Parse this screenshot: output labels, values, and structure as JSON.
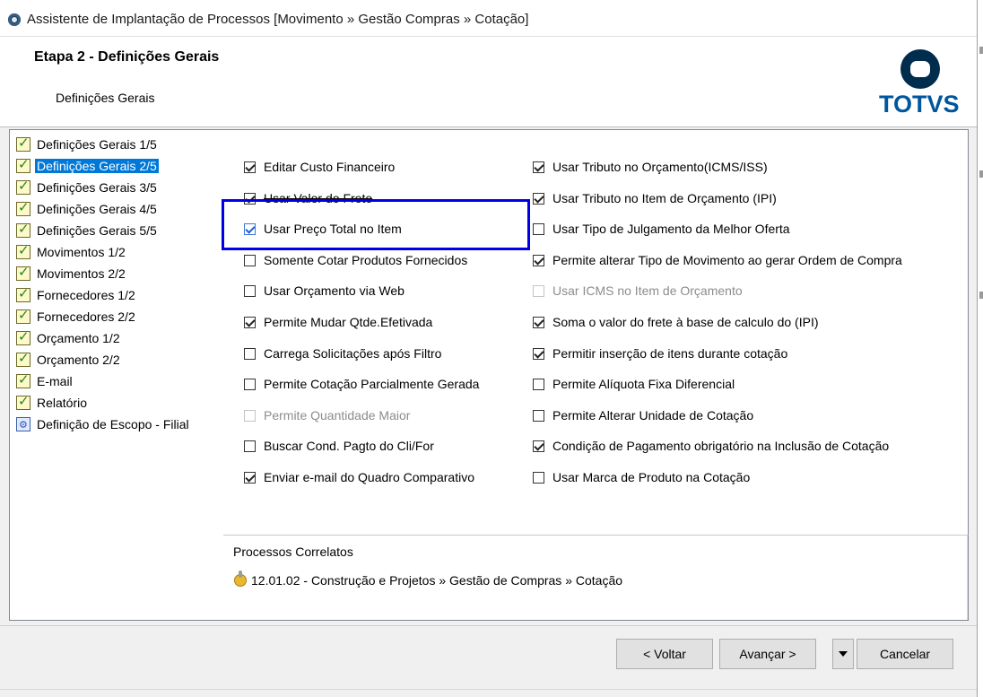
{
  "window": {
    "title": "Assistente de Implantação de Processos [Movimento » Gestão Compras » Cotação]"
  },
  "header": {
    "step_title": "Etapa 2 - Definições Gerais",
    "subtitle": "Definições Gerais",
    "logo_text": "TOTVS"
  },
  "steps": [
    {
      "label": "Definições Gerais 1/5",
      "icon": "checklist-icon"
    },
    {
      "label": "Definições Gerais 2/5",
      "icon": "checklist-icon",
      "selected": true
    },
    {
      "label": "Definições Gerais 3/5",
      "icon": "checklist-icon"
    },
    {
      "label": "Definições Gerais 4/5",
      "icon": "checklist-icon"
    },
    {
      "label": "Definições Gerais 5/5",
      "icon": "checklist-icon"
    },
    {
      "label": "Movimentos 1/2",
      "icon": "checklist-icon"
    },
    {
      "label": "Movimentos 2/2",
      "icon": "checklist-icon"
    },
    {
      "label": "Fornecedores 1/2",
      "icon": "checklist-icon"
    },
    {
      "label": "Fornecedores 2/2",
      "icon": "checklist-icon"
    },
    {
      "label": "Orçamento 1/2",
      "icon": "checklist-icon"
    },
    {
      "label": "Orçamento 2/2",
      "icon": "checklist-icon"
    },
    {
      "label": "E-mail",
      "icon": "checklist-icon"
    },
    {
      "label": "Relatório",
      "icon": "checklist-icon"
    },
    {
      "label": "Definição de Escopo - Filial",
      "icon": "scope-icon"
    }
  ],
  "options_left": [
    {
      "label": "Editar Custo Financeiro",
      "checked": true
    },
    {
      "label": "Usar Valor do Frete",
      "checked": true,
      "struck": true
    },
    {
      "label": "Usar  Preço Total no Item",
      "checked": true,
      "highlighted": true
    },
    {
      "label": "Somente Cotar Produtos Fornecidos",
      "checked": false
    },
    {
      "label": "Usar Orçamento via Web",
      "checked": false
    },
    {
      "label": "Permite Mudar Qtde.Efetivada",
      "checked": true
    },
    {
      "label": "Carrega Solicitações após Filtro",
      "checked": false
    },
    {
      "label": "Permite Cotação Parcialmente Gerada",
      "checked": false
    },
    {
      "label": "Permite Quantidade Maior",
      "checked": false,
      "disabled": true
    },
    {
      "label": "Buscar Cond. Pagto do Cli/For",
      "checked": false
    },
    {
      "label": "Enviar e-mail do Quadro Comparativo",
      "checked": true
    }
  ],
  "options_right": [
    {
      "label": "Usar Tributo no Orçamento(ICMS/ISS)",
      "checked": true
    },
    {
      "label": "Usar Tributo no Item de Orçamento (IPI)",
      "checked": true
    },
    {
      "label": "Usar Tipo de Julgamento da Melhor Oferta",
      "checked": false
    },
    {
      "label": "Permite alterar Tipo de Movimento ao gerar Ordem de Compra",
      "checked": true
    },
    {
      "label": "Usar ICMS no Item de Orçamento",
      "checked": false,
      "disabled": true
    },
    {
      "label": "Soma o valor do frete à base de calculo do (IPI)",
      "checked": true
    },
    {
      "label": "Permitir inserção de itens durante cotação",
      "checked": true
    },
    {
      "label": "Permite Alíquota Fixa Diferencial",
      "checked": false
    },
    {
      "label": "Permite Alterar Unidade de Cotação",
      "checked": false
    },
    {
      "label": "Condição de Pagamento obrigatório na Inclusão de Cotação",
      "checked": true
    },
    {
      "label": "Usar Marca de Produto na Cotação",
      "checked": false
    }
  ],
  "related": {
    "title": "Processos Correlatos",
    "item": "12.01.02 - Construção e Projetos » Gestão de Compras » Cotação"
  },
  "buttons": {
    "back": "< Voltar",
    "next": "Avançar >",
    "cancel": "Cancelar"
  }
}
